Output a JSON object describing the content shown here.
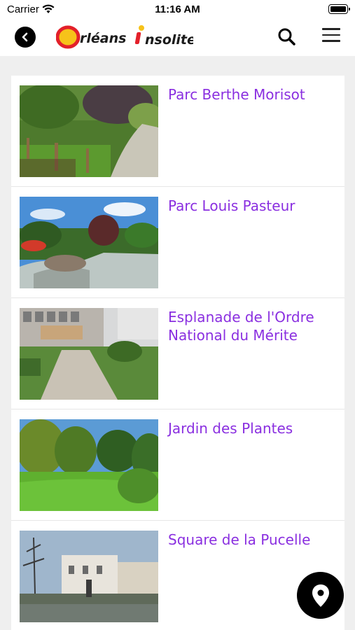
{
  "status": {
    "carrier": "Carrier",
    "time": "11:16 AM"
  },
  "header": {
    "logo_text": "Orléans insolite"
  },
  "places": [
    {
      "title": "Parc Berthe Morisot",
      "image": "park-garden-photo"
    },
    {
      "title": "Parc Louis Pasteur",
      "image": "park-pond-photo"
    },
    {
      "title": "Esplanade de l'Ordre National du Mérite",
      "image": "esplanade-photo"
    },
    {
      "title": "Jardin des Plantes",
      "image": "garden-lawn-photo"
    },
    {
      "title": "Square de la Pucelle",
      "image": "square-street-photo"
    }
  ],
  "colors": {
    "title": "#8a2fe0",
    "logo_red": "#e3202a",
    "logo_yellow": "#f6c21a"
  }
}
